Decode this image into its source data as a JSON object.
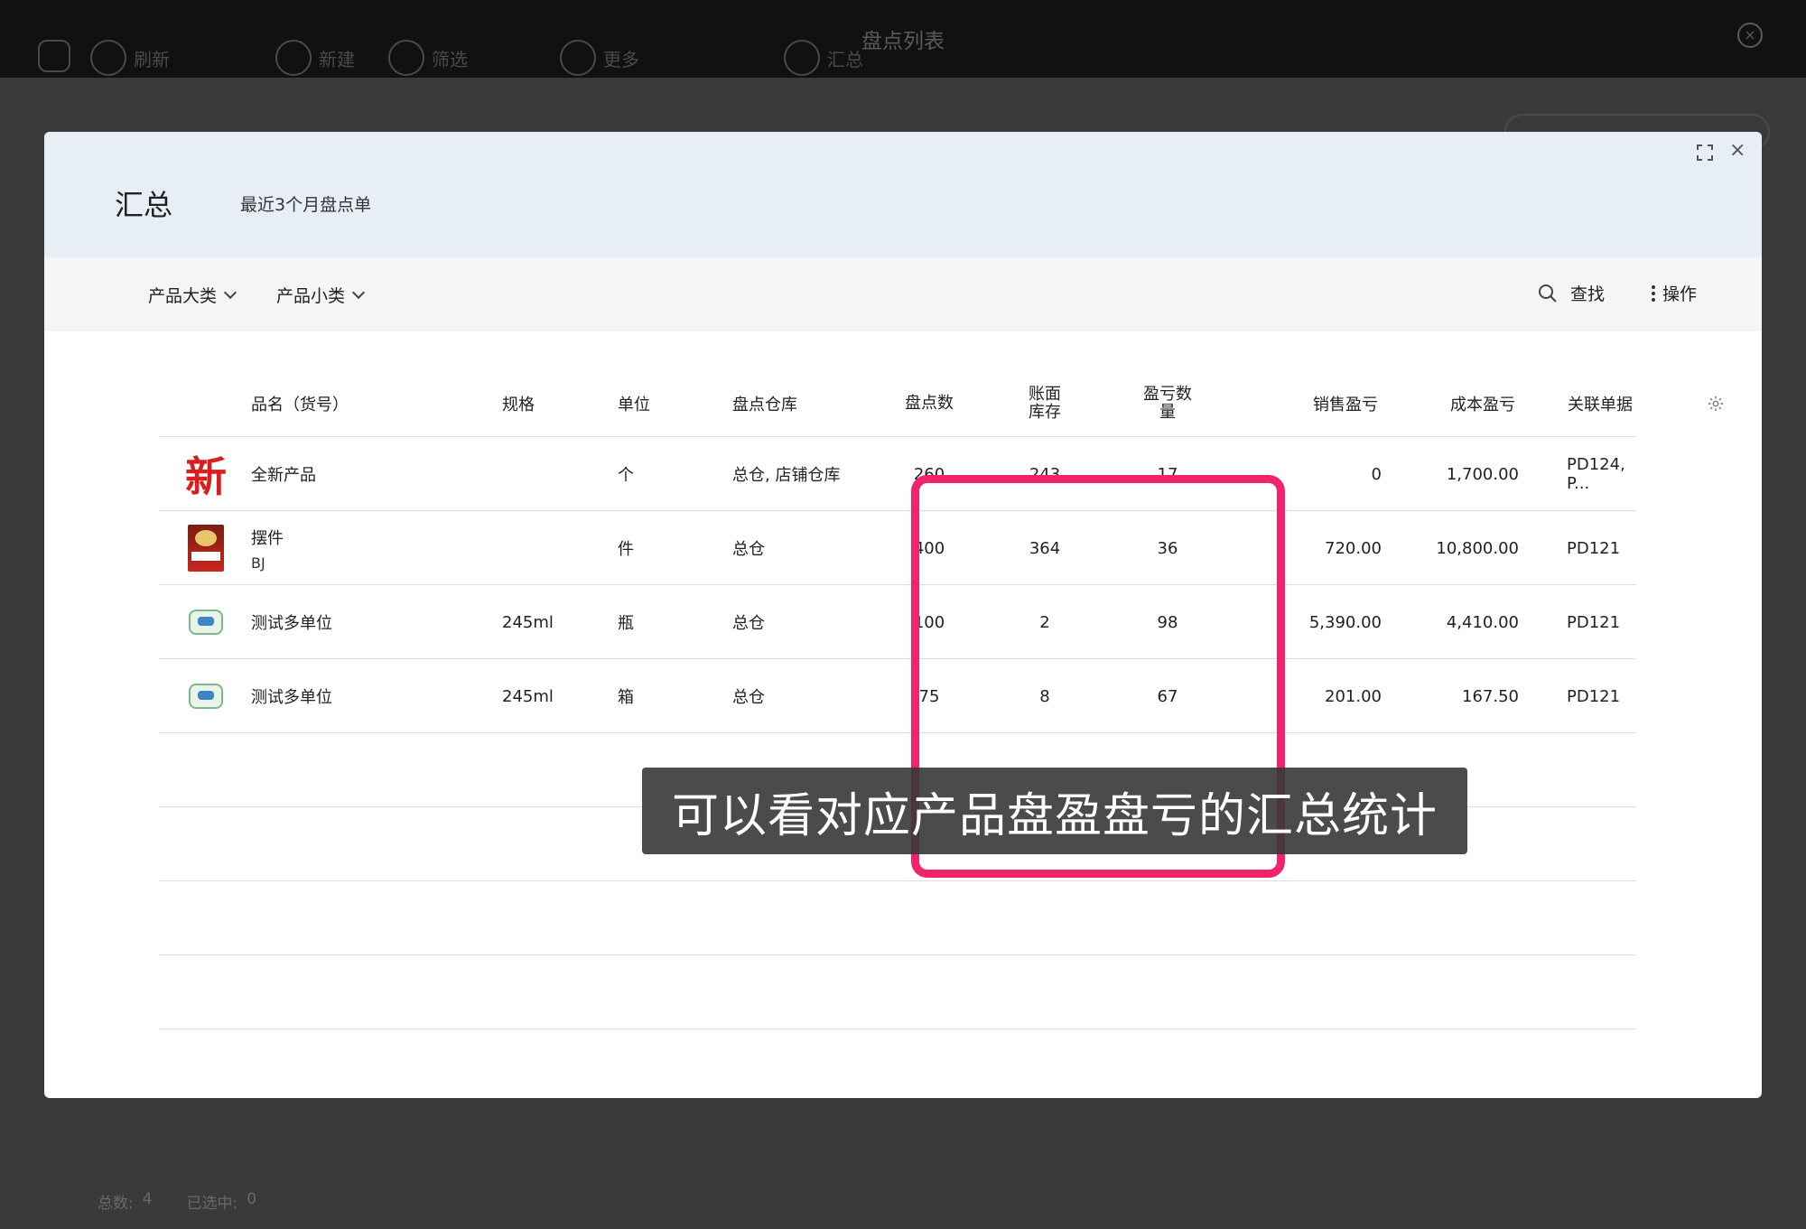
{
  "app": {
    "title": "盘点列表",
    "toolbar": [
      "刷新",
      "新建",
      "筛选",
      "更多",
      "汇总"
    ],
    "footer": {
      "total_label": "总数:",
      "total": "4",
      "selected_label": "已选中:",
      "selected": "0"
    }
  },
  "modal": {
    "title": "汇总",
    "subtitle": "最近3个月盘点单",
    "filters": [
      "产品大类",
      "产品小类"
    ],
    "find_label": "查找",
    "ops_label": "操作"
  },
  "table": {
    "headers": {
      "name": "品名（货号）",
      "spec": "规格",
      "unit": "单位",
      "warehouse": "盘点仓库",
      "count": "盘点数",
      "book_stock": "账面库存",
      "diff_qty": "盈亏数量",
      "sales_diff": "销售盈亏",
      "cost_diff": "成本盈亏",
      "ref_doc": "关联单据"
    },
    "rows": [
      {
        "thumb": "new-product-icon",
        "thumb_text": "新",
        "name": "全新产品",
        "sku": "",
        "spec": "",
        "unit": "个",
        "warehouse": "总仓, 店铺仓库",
        "count": "260",
        "book_stock": "243",
        "diff_qty": "17",
        "sales_diff": "0",
        "cost_diff": "1,700.00",
        "ref_doc": "PD124, P..."
      },
      {
        "thumb": "product-box-image",
        "thumb_text": "",
        "name": "摆件",
        "sku": "BJ",
        "spec": "",
        "unit": "件",
        "warehouse": "总仓",
        "count": "400",
        "book_stock": "364",
        "diff_qty": "36",
        "sales_diff": "720.00",
        "cost_diff": "10,800.00",
        "ref_doc": "PD121"
      },
      {
        "thumb": "bottle-image",
        "thumb_text": "",
        "name": "测试多单位",
        "sku": "",
        "spec": "245ml",
        "unit": "瓶",
        "warehouse": "总仓",
        "count": "100",
        "book_stock": "2",
        "diff_qty": "98",
        "sales_diff": "5,390.00",
        "cost_diff": "4,410.00",
        "ref_doc": "PD121"
      },
      {
        "thumb": "bottle-image",
        "thumb_text": "",
        "name": "测试多单位",
        "sku": "",
        "spec": "245ml",
        "unit": "箱",
        "warehouse": "总仓",
        "count": "75",
        "book_stock": "8",
        "diff_qty": "67",
        "sales_diff": "201.00",
        "cost_diff": "167.50",
        "ref_doc": "PD121"
      }
    ]
  },
  "caption": "可以看对应产品盘盈盘亏的汇总统计",
  "colors": {
    "highlight": "#f0246a",
    "header_bg": "#e8eef5",
    "filter_bg": "#f5f5f5"
  }
}
